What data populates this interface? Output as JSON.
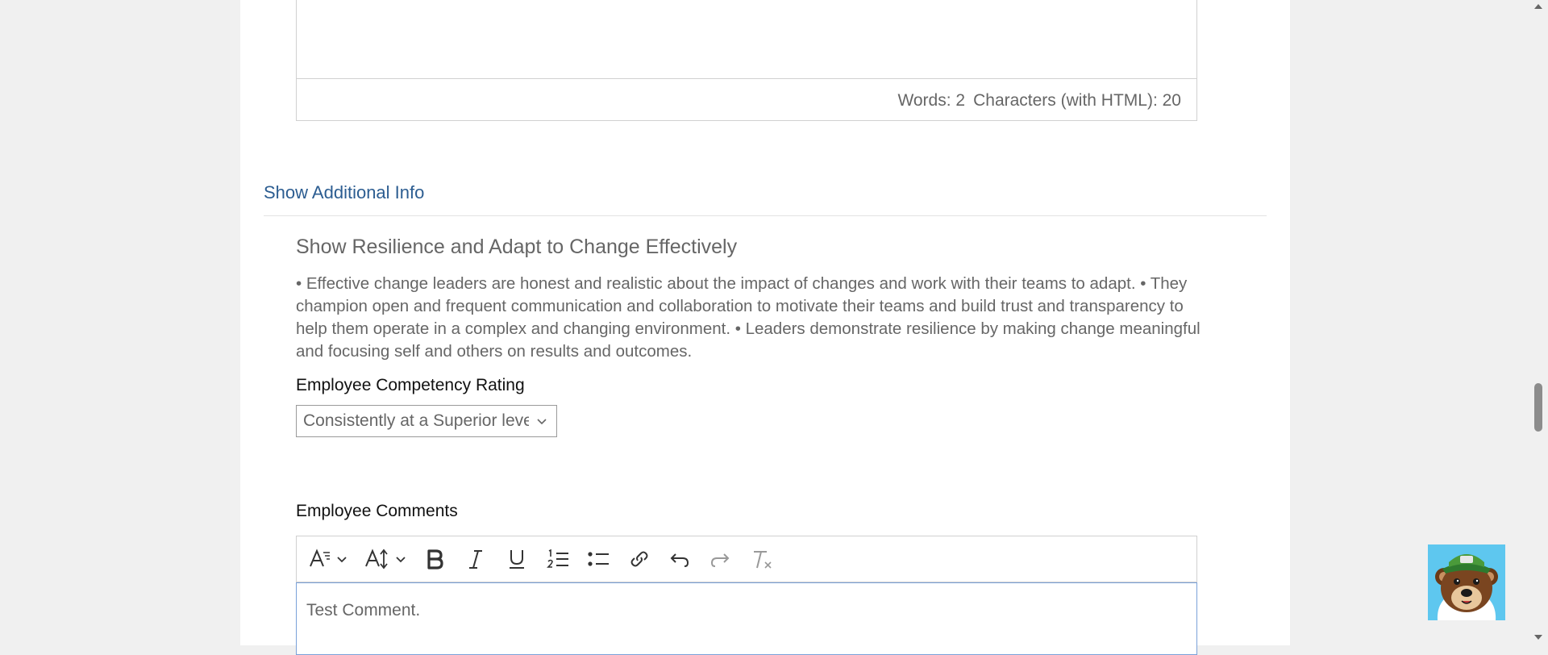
{
  "top_editor": {
    "words": "Words: 2",
    "characters": "Characters (with HTML): 20"
  },
  "show_additional_info": "Show Additional Info",
  "competency": {
    "title": "Show Resilience and Adapt to Change Effectively",
    "description": "• Effective change leaders are honest and realistic about the impact of changes and work with their teams to adapt. • They champion open and frequent communication and collaboration to motivate their teams and build trust and transparency to help them operate in a complex and changing environment. • Leaders demonstrate resilience by making change meaningful and focusing self and others on results and outcomes.",
    "rating_label": "Employee Competency Rating",
    "rating_value": "Consistently at a Superior level"
  },
  "comments": {
    "label": "Employee Comments",
    "text": "Test Comment.",
    "toolbar": [
      "paragraph-format-icon",
      "font-size-icon",
      "bold-icon",
      "italic-icon",
      "underline-icon",
      "ordered-list-icon",
      "unordered-list-icon",
      "link-icon",
      "undo-icon",
      "redo-icon",
      "clear-formatting-icon"
    ]
  },
  "colors": {
    "link": "#2c5d91",
    "focus_border": "#7aa1d9",
    "avatar_bg": "#5ec7ef"
  }
}
